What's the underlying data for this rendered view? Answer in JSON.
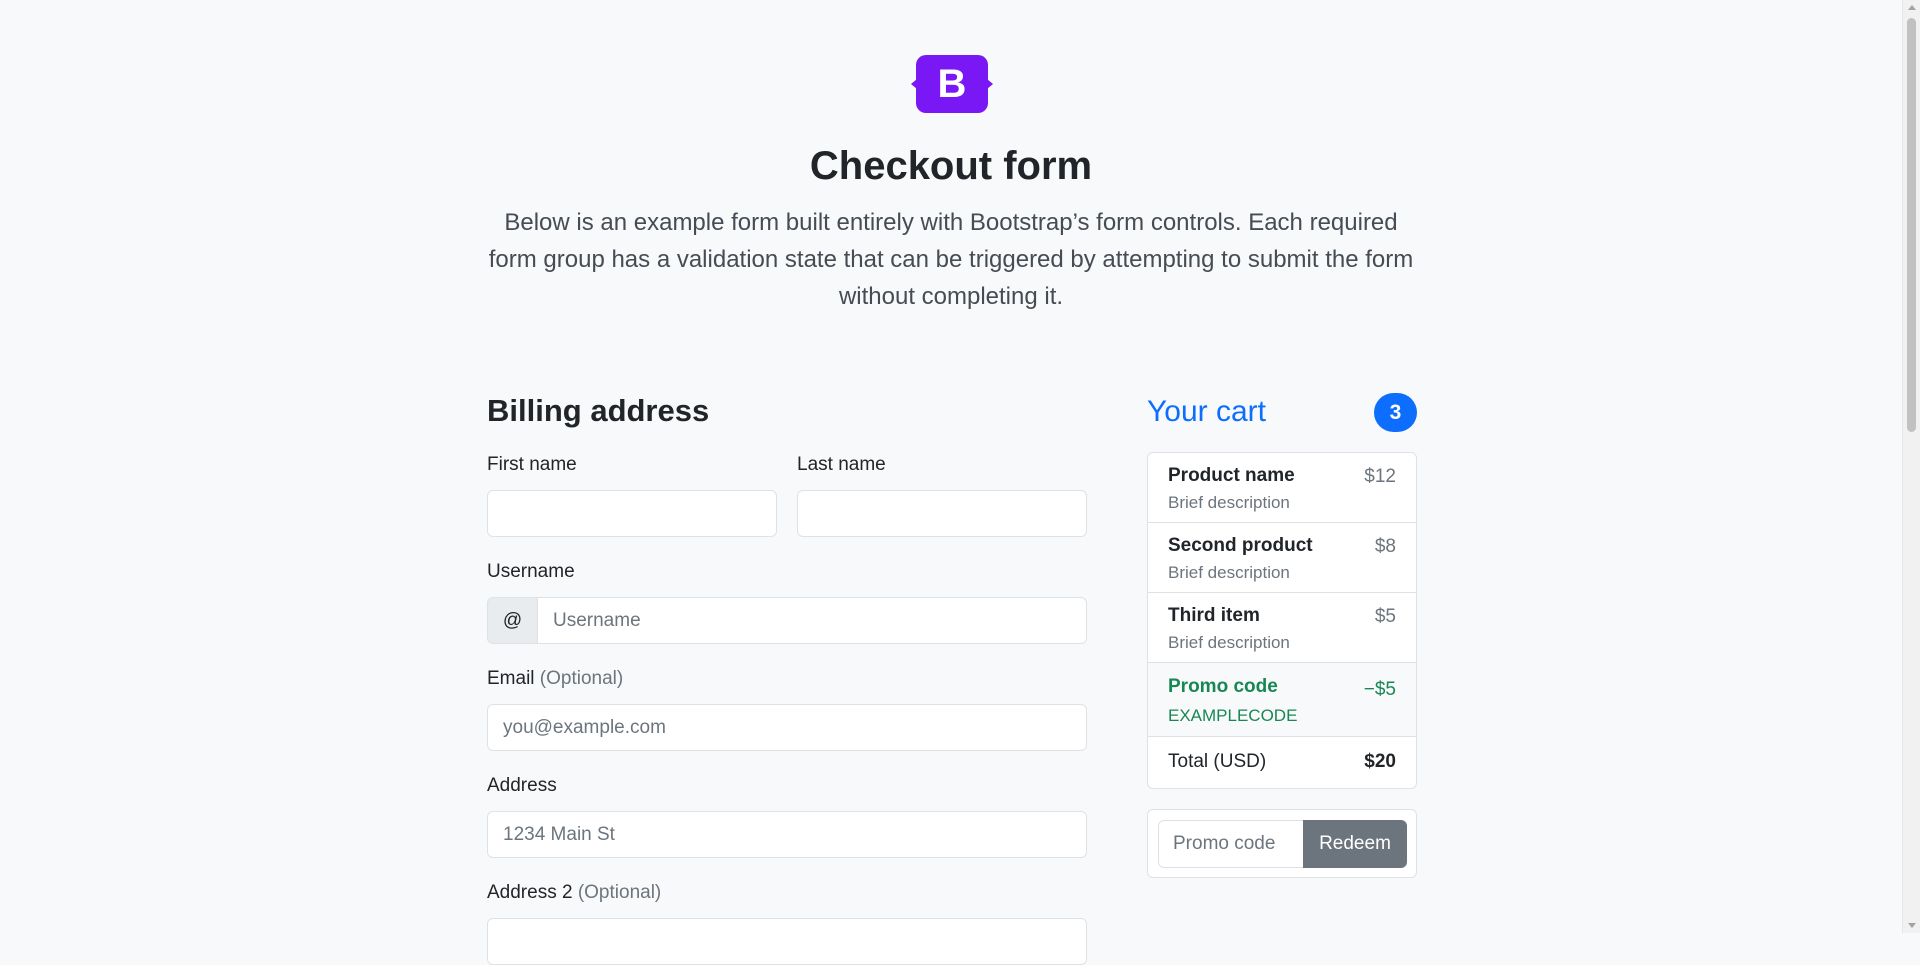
{
  "header": {
    "logo_letter": "B",
    "title": "Checkout form",
    "lead": "Below is an example form built entirely with Bootstrap’s form controls. Each required form group has a validation state that can be triggered by attempting to submit the form without completing it."
  },
  "billing": {
    "heading": "Billing address",
    "first_name": {
      "label": "First name",
      "value": "",
      "placeholder": ""
    },
    "last_name": {
      "label": "Last name",
      "value": "",
      "placeholder": ""
    },
    "username": {
      "label": "Username",
      "prefix": "@",
      "placeholder": "Username"
    },
    "email": {
      "label": "Email",
      "optional": "(Optional)",
      "placeholder": "you@example.com"
    },
    "address": {
      "label": "Address",
      "placeholder": "1234 Main St"
    },
    "address2": {
      "label": "Address 2",
      "optional": "(Optional)",
      "placeholder": ""
    }
  },
  "cart": {
    "title": "Your cart",
    "count": "3",
    "items": [
      {
        "name": "Product name",
        "desc": "Brief description",
        "price": "$12"
      },
      {
        "name": "Second product",
        "desc": "Brief description",
        "price": "$8"
      },
      {
        "name": "Third item",
        "desc": "Brief description",
        "price": "$5"
      }
    ],
    "promo": {
      "name": "Promo code",
      "code": "EXAMPLECODE",
      "amount": "−$5"
    },
    "total": {
      "label": "Total (USD)",
      "amount": "$20"
    },
    "promo_form": {
      "placeholder": "Promo code",
      "button": "Redeem"
    }
  },
  "colors": {
    "brand": "#7a17f5",
    "primary": "#0d6efd",
    "success": "#198754",
    "secondary": "#6c757d"
  }
}
